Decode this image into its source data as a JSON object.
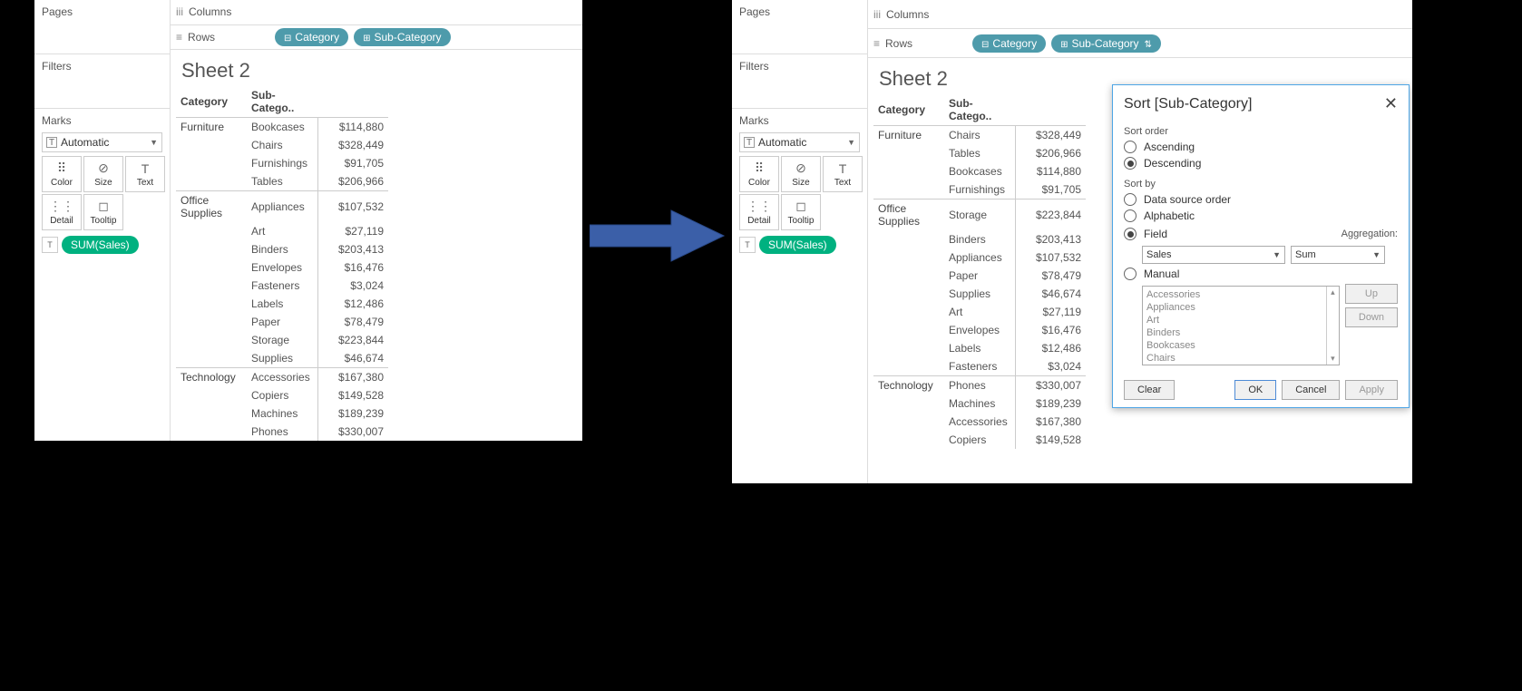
{
  "shelves": {
    "pages": "Pages",
    "filters": "Filters",
    "marks": "Marks",
    "columns": "Columns",
    "rows": "Rows",
    "automatic": "Automatic",
    "mark_buttons": [
      "Color",
      "Size",
      "Text",
      "Detail",
      "Tooltip"
    ],
    "sum_sales": "SUM(Sales)",
    "pills": {
      "category": "Category",
      "subcategory": "Sub-Category"
    }
  },
  "sheet_title": "Sheet 2",
  "table_headers": {
    "category": "Category",
    "subcategory": "Sub-Catego.."
  },
  "left_data": [
    {
      "category": "Furniture",
      "rows": [
        {
          "sub": "Bookcases",
          "val": "$114,880"
        },
        {
          "sub": "Chairs",
          "val": "$328,449"
        },
        {
          "sub": "Furnishings",
          "val": "$91,705"
        },
        {
          "sub": "Tables",
          "val": "$206,966"
        }
      ]
    },
    {
      "category": "Office Supplies",
      "rows": [
        {
          "sub": "Appliances",
          "val": "$107,532"
        },
        {
          "sub": "Art",
          "val": "$27,119"
        },
        {
          "sub": "Binders",
          "val": "$203,413"
        },
        {
          "sub": "Envelopes",
          "val": "$16,476"
        },
        {
          "sub": "Fasteners",
          "val": "$3,024"
        },
        {
          "sub": "Labels",
          "val": "$12,486"
        },
        {
          "sub": "Paper",
          "val": "$78,479"
        },
        {
          "sub": "Storage",
          "val": "$223,844"
        },
        {
          "sub": "Supplies",
          "val": "$46,674"
        }
      ]
    },
    {
      "category": "Technology",
      "rows": [
        {
          "sub": "Accessories",
          "val": "$167,380"
        },
        {
          "sub": "Copiers",
          "val": "$149,528"
        },
        {
          "sub": "Machines",
          "val": "$189,239"
        },
        {
          "sub": "Phones",
          "val": "$330,007"
        }
      ]
    }
  ],
  "right_data": [
    {
      "category": "Furniture",
      "rows": [
        {
          "sub": "Chairs",
          "val": "$328,449"
        },
        {
          "sub": "Tables",
          "val": "$206,966"
        },
        {
          "sub": "Bookcases",
          "val": "$114,880"
        },
        {
          "sub": "Furnishings",
          "val": "$91,705"
        }
      ]
    },
    {
      "category": "Office Supplies",
      "rows": [
        {
          "sub": "Storage",
          "val": "$223,844"
        },
        {
          "sub": "Binders",
          "val": "$203,413"
        },
        {
          "sub": "Appliances",
          "val": "$107,532"
        },
        {
          "sub": "Paper",
          "val": "$78,479"
        },
        {
          "sub": "Supplies",
          "val": "$46,674"
        },
        {
          "sub": "Art",
          "val": "$27,119"
        },
        {
          "sub": "Envelopes",
          "val": "$16,476"
        },
        {
          "sub": "Labels",
          "val": "$12,486"
        },
        {
          "sub": "Fasteners",
          "val": "$3,024"
        }
      ]
    },
    {
      "category": "Technology",
      "rows": [
        {
          "sub": "Phones",
          "val": "$330,007"
        },
        {
          "sub": "Machines",
          "val": "$189,239"
        },
        {
          "sub": "Accessories",
          "val": "$167,380"
        },
        {
          "sub": "Copiers",
          "val": "$149,528"
        }
      ]
    }
  ],
  "dialog": {
    "title": "Sort [Sub-Category]",
    "sort_order_label": "Sort order",
    "ascending": "Ascending",
    "descending": "Descending",
    "sort_by_label": "Sort by",
    "opt_dso": "Data source order",
    "opt_alpha": "Alphabetic",
    "opt_field": "Field",
    "aggregation_label": "Aggregation:",
    "field_value": "Sales",
    "agg_value": "Sum",
    "opt_manual": "Manual",
    "manual_items": [
      "Accessories",
      "Appliances",
      "Art",
      "Binders",
      "Bookcases",
      "Chairs"
    ],
    "btn_up": "Up",
    "btn_down": "Down",
    "btn_clear": "Clear",
    "btn_ok": "OK",
    "btn_cancel": "Cancel",
    "btn_apply": "Apply"
  }
}
